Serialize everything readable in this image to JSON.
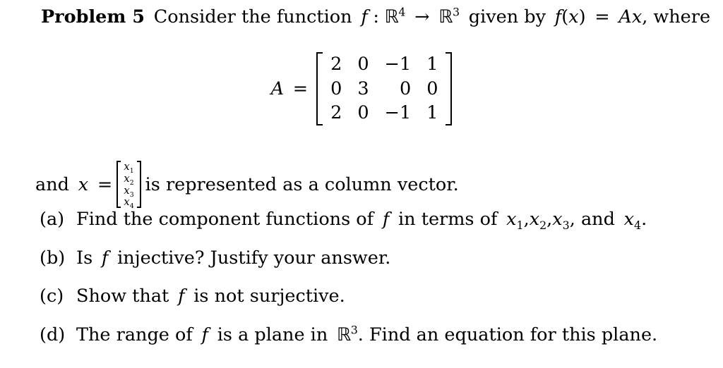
{
  "document": {
    "problem_label": "Problem 5",
    "intro": {
      "text_1": "Consider the function",
      "function_name": "f",
      "colon": ":",
      "domain_symbol": "R",
      "domain_exponent": "4",
      "arrow": "→",
      "codomain_symbol": "R",
      "codomain_exponent": "3",
      "text_2": "given by",
      "equation": "f(x) = Ax",
      "equation_f": "f",
      "equation_open": "(",
      "equation_x": "x",
      "equation_close": ")",
      "equation_equals": "=",
      "equation_A": "A",
      "equation_Ax_x": "x",
      "text_3": ", where"
    },
    "matrix_equation": {
      "lhs_symbol": "A",
      "lhs_equals": "=",
      "matrix": {
        "rows": [
          [
            "2",
            "0",
            "−1",
            "1"
          ],
          [
            "0",
            "3",
            "0",
            "0"
          ],
          [
            "2",
            "0",
            "−1",
            "1"
          ]
        ],
        "row_count": 3,
        "col_count": 4,
        "column_alignment": [
          "center",
          "center",
          "right",
          "right"
        ],
        "bracket_style": "square"
      }
    },
    "vector_line": {
      "text_1": "and",
      "variable": "x",
      "equals": "=",
      "vector_entries": [
        "x1",
        "x2",
        "x3",
        "x4"
      ],
      "vector_entries_base": [
        "x",
        "x",
        "x",
        "x"
      ],
      "vector_entries_sub": [
        "1",
        "2",
        "3",
        "4"
      ],
      "text_2": "is represented as a column vector."
    },
    "parts": [
      {
        "label": "(a)",
        "text_1": "Find the component functions of",
        "math_f": "f",
        "text_2": "in terms of",
        "vars": [
          "x1",
          "x2",
          "x3"
        ],
        "var_base": "x",
        "var_subs": [
          "1",
          "2",
          "3"
        ],
        "text_3": ", and",
        "last_var_base": "x",
        "last_var_sub": "4",
        "text_4": ".",
        "full_text": "(a) Find the component functions of f in terms of x1, x2, x3, and x4."
      },
      {
        "label": "(b)",
        "text_1": "Is",
        "math_f": "f",
        "text_2": "injective?  Justify your answer.",
        "full_text": "(b) Is f injective? Justify your answer."
      },
      {
        "label": "(c)",
        "text_1": "Show that",
        "math_f": "f",
        "text_2": "is not surjective.",
        "full_text": "(c) Show that f is not surjective."
      },
      {
        "label": "(d)",
        "text_1": "The range of",
        "math_f": "f",
        "text_2": "is a plane in",
        "space_symbol": "R",
        "space_exponent": "3",
        "text_3": ". Find an equation for this plane.",
        "full_text": "(d) The range of f is a plane in R3. Find an equation for this plane."
      }
    ]
  },
  "style": {
    "text_color": "#000000",
    "background_color": "#ffffff"
  }
}
